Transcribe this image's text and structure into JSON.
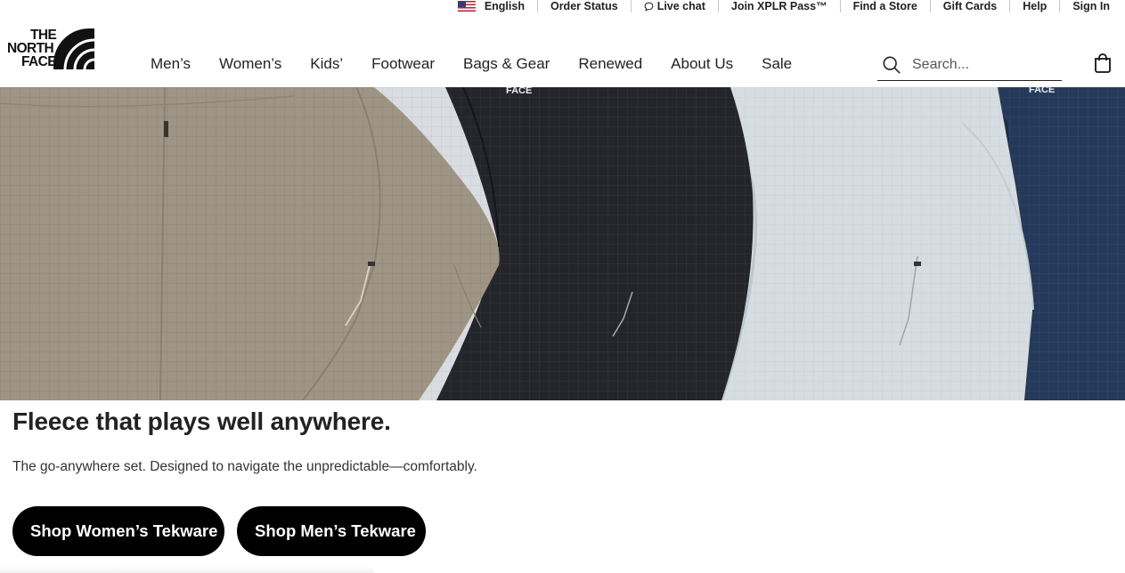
{
  "utility_bar": {
    "items": [
      {
        "label": "English",
        "icon": "us-flag-icon"
      },
      {
        "label": "Order Status"
      },
      {
        "label": "Live chat",
        "icon": "chat-bubble-icon"
      },
      {
        "label": "Join XPLR Pass™"
      },
      {
        "label": "Find a Store"
      },
      {
        "label": "Gift Cards"
      },
      {
        "label": "Help"
      },
      {
        "label": "Sign In"
      }
    ]
  },
  "header": {
    "logo": {
      "lines": [
        "THE",
        "NORTH",
        "FACE"
      ]
    },
    "nav": [
      "Men’s",
      "Women’s",
      "Kids’",
      "Footwear",
      "Bags & Gear",
      "Renewed",
      "About Us",
      "Sale"
    ],
    "search": {
      "placeholder": "Search...",
      "value": "",
      "icon": "search-icon"
    },
    "cart": {
      "icon": "shopping-bag-icon"
    }
  },
  "hero": {
    "image": "four Tekware fleece jackets in taupe, black, pale blue and navy",
    "jacket_colors": [
      "#9f9586",
      "#23252b",
      "#d5dde2",
      "#253a5b"
    ],
    "brand_mark_text": "FACE"
  },
  "promo": {
    "headline": "Fleece that plays well anywhere.",
    "subtext": "The go-anywhere set. Designed to navigate the unpredictable—comfortably.",
    "buttons": [
      "Shop Women’s Tekware",
      "Shop Men’s Tekware"
    ]
  },
  "colors": {
    "text": "#222222",
    "button_bg": "#000000",
    "button_text": "#ffffff"
  }
}
